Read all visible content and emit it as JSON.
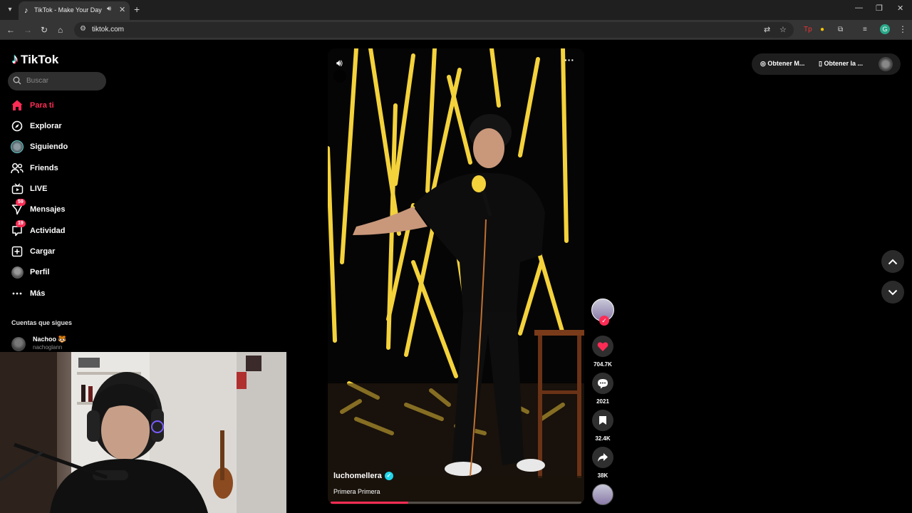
{
  "browser": {
    "tab_title": "TikTok - Make Your Day",
    "url": "tiktok.com"
  },
  "sidebar": {
    "logo": "TikTok",
    "search_placeholder": "Buscar",
    "items": [
      {
        "label": "Para ti",
        "icon": "home-icon",
        "active": true
      },
      {
        "label": "Explorar",
        "icon": "compass-icon"
      },
      {
        "label": "Siguiendo",
        "icon": "following-avatar"
      },
      {
        "label": "Friends",
        "icon": "friends-icon"
      },
      {
        "label": "LIVE",
        "icon": "live-icon"
      },
      {
        "label": "Mensajes",
        "icon": "messages-icon",
        "badge": "59"
      },
      {
        "label": "Actividad",
        "icon": "activity-icon",
        "badge": "19"
      },
      {
        "label": "Cargar",
        "icon": "upload-icon"
      },
      {
        "label": "Perfil",
        "icon": "profile-avatar"
      },
      {
        "label": "Más",
        "icon": "more-icon"
      }
    ],
    "following_title": "Cuentas que sigues",
    "following": [
      {
        "name": "Nachoo 🐯",
        "handle": "nachoglann"
      }
    ]
  },
  "video": {
    "author": "luchomellera",
    "description": "Primera Primera",
    "progress": 0.31
  },
  "actions": {
    "likes": "704.7K",
    "comments": "2021",
    "saves": "32.4K",
    "shares": "38K"
  },
  "topbar": {
    "get_app_1": "Obtener M...",
    "get_app_2": "Obtener la ..."
  },
  "colors": {
    "accent": "#fe2c55",
    "verified": "#20d5ec"
  }
}
